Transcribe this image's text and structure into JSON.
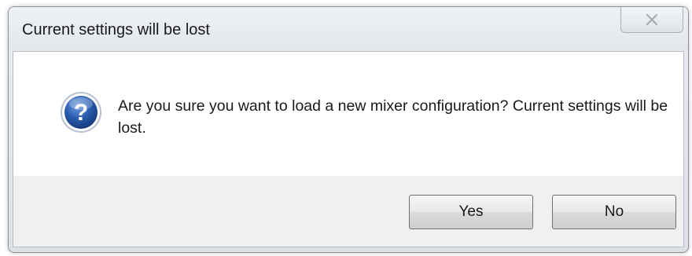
{
  "window": {
    "title": "Current settings will be lost"
  },
  "dialog": {
    "icon": "question-icon",
    "message": "Are you sure you want to load a new mixer configuration?  Current settings will be lost."
  },
  "buttons": {
    "yes_label": "Yes",
    "no_label": "No"
  },
  "colors": {
    "icon_blue": "#2a5db0",
    "window_frame": "#dde1e6",
    "content_background": "#ffffff",
    "button_area_background": "#f0f0f0"
  }
}
